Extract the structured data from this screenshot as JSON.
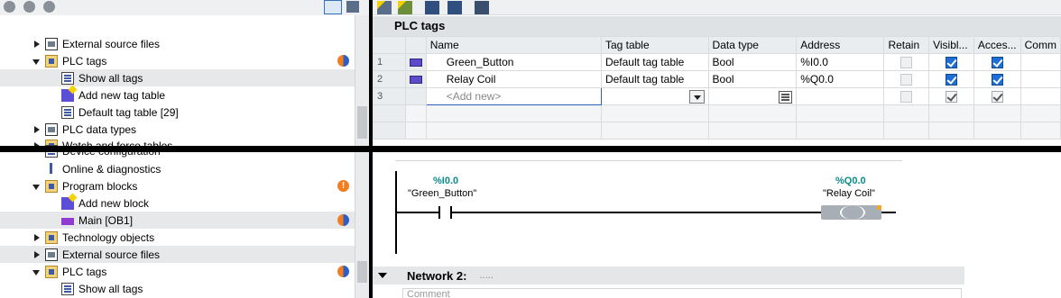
{
  "tree": {
    "items": [
      {
        "label": "External source files",
        "icon": "file-icon",
        "arrow": "right",
        "indent": 2,
        "badge": ""
      },
      {
        "label": "PLC tags",
        "icon": "folder-icon",
        "arrow": "down",
        "indent": 2,
        "badge": "half"
      },
      {
        "label": "Show all tags",
        "icon": "tag-table-icon",
        "arrow": "",
        "indent": 3,
        "badge": "",
        "selected": true
      },
      {
        "label": "Add new tag table",
        "icon": "add-icon",
        "arrow": "",
        "indent": 3,
        "badge": ""
      },
      {
        "label": "Default tag table [29]",
        "icon": "tag-table-icon",
        "arrow": "",
        "indent": 3,
        "badge": ""
      },
      {
        "label": "PLC data types",
        "icon": "file-icon",
        "arrow": "right",
        "indent": 2,
        "badge": ""
      },
      {
        "label": "Watch and force tables",
        "icon": "folder-icon",
        "arrow": "right",
        "indent": 2,
        "badge": ""
      },
      {
        "label": "Device configuration",
        "icon": "doc-icon",
        "arrow": "",
        "indent": 2,
        "badge": ""
      },
      {
        "label": "Online & diagnostics",
        "icon": "online-icon",
        "arrow": "",
        "indent": 2,
        "badge": ""
      },
      {
        "label": "Program blocks",
        "icon": "folder-icon",
        "arrow": "down",
        "indent": 2,
        "badge": "warn"
      },
      {
        "label": "Add new block",
        "icon": "add-icon",
        "arrow": "",
        "indent": 3,
        "badge": ""
      },
      {
        "label": "Main [OB1]",
        "icon": "ob-icon",
        "arrow": "",
        "indent": 3,
        "badge": "half",
        "selected": true
      },
      {
        "label": "Technology objects",
        "icon": "folder-icon",
        "arrow": "right",
        "indent": 2,
        "badge": ""
      },
      {
        "label": "External source files",
        "icon": "file-icon",
        "arrow": "right",
        "indent": 2,
        "badge": "",
        "selected": true
      },
      {
        "label": "PLC tags",
        "icon": "folder-icon",
        "arrow": "down",
        "indent": 2,
        "badge": "half"
      },
      {
        "label": "Show all tags",
        "icon": "tag-table-icon",
        "arrow": "",
        "indent": 3,
        "badge": ""
      }
    ]
  },
  "tag_table": {
    "title": "PLC tags",
    "columns": [
      "Name",
      "Tag table",
      "Data type",
      "Address",
      "Retain",
      "Visibl...",
      "Acces...",
      "Comm"
    ],
    "rows": [
      {
        "num": "1",
        "name": "Green_Button",
        "table": "Default tag table",
        "type": "Bool",
        "address": "%I0.0"
      },
      {
        "num": "2",
        "name": "Relay Coil",
        "table": "Default tag table",
        "type": "Bool",
        "address": "%Q0.0"
      }
    ],
    "new_row": {
      "num": "3",
      "placeholder": "<Add new>"
    }
  },
  "ladder": {
    "contact_addr": "%I0.0",
    "contact_sym": "\"Green_Button\"",
    "coil_addr": "%Q0.0",
    "coil_sym": "\"Relay Coil\"",
    "network_title": "Network 2:",
    "network_dots": ".....",
    "comment_placeholder": "Comment"
  }
}
